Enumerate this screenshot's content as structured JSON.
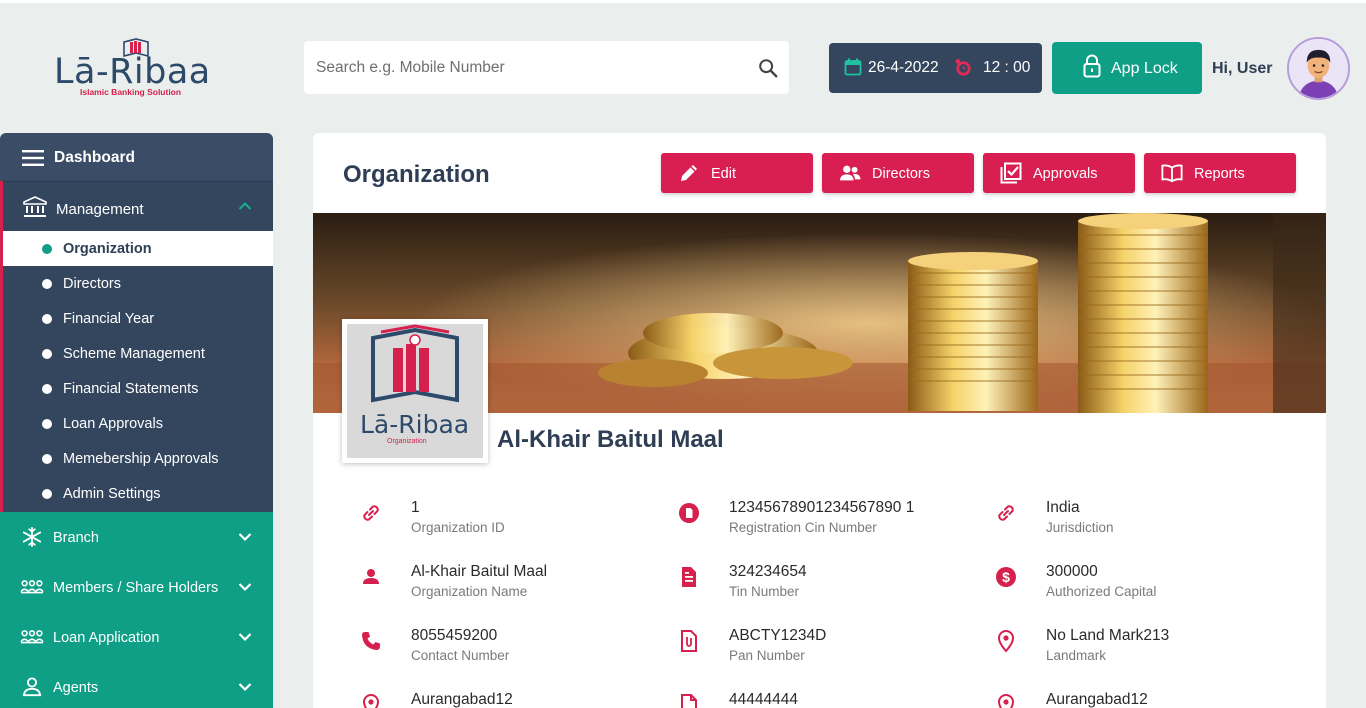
{
  "brand": {
    "name": "Lā-Ribaa",
    "tagline": "Islamic Banking Solution",
    "accent": "#d6204e",
    "navy": "#33465e",
    "teal": "#0f9e86"
  },
  "search": {
    "placeholder": "Search e.g. Mobile Number",
    "value": "",
    "icon": "search-icon"
  },
  "header": {
    "date": "26-4-2022",
    "time": "12 : 00",
    "app_lock_label": "App Lock",
    "greeting": "Hi, User"
  },
  "sidebar": {
    "dashboard": "Dashboard",
    "management": {
      "label": "Management",
      "items": [
        {
          "label": "Organization",
          "active": true
        },
        {
          "label": "Directors"
        },
        {
          "label": "Financial Year"
        },
        {
          "label": "Scheme Management"
        },
        {
          "label": "Financial Statements"
        },
        {
          "label": "Loan Approvals"
        },
        {
          "label": "Memebership Approvals"
        },
        {
          "label": "Admin Settings"
        }
      ]
    },
    "groups": [
      {
        "label": "Branch",
        "icon": "snowflake-icon"
      },
      {
        "label": "Members / Share Holders",
        "icon": "users-group-icon"
      },
      {
        "label": "Loan Application",
        "icon": "users-group-icon"
      },
      {
        "label": "Agents",
        "icon": "user-icon"
      }
    ]
  },
  "main": {
    "title": "Organization",
    "actions": [
      {
        "label": "Edit",
        "icon": "pencil-icon"
      },
      {
        "label": "Directors",
        "icon": "people-icon"
      },
      {
        "label": "Approvals",
        "icon": "checklist-icon"
      },
      {
        "label": "Reports",
        "icon": "book-icon"
      }
    ],
    "org_logo_text": "Lā-Ribaa",
    "org_logo_sub": "Organization",
    "org_name": "Al-Khair Baitul Maal",
    "fields": [
      {
        "value": "1",
        "label": "Organization ID",
        "icon": "link-icon"
      },
      {
        "value": "12345678901234567890 1",
        "label": "Registration Cin Number",
        "icon": "document-icon"
      },
      {
        "value": "India",
        "label": "Jurisdiction",
        "icon": "link-icon"
      },
      {
        "value": "Al-Khair Baitul Maal",
        "label": "Organization Name",
        "icon": "person-icon"
      },
      {
        "value": "324234654",
        "label": "Tin Number",
        "icon": "file-text-icon"
      },
      {
        "value": "300000",
        "label": "Authorized Capital",
        "icon": "dollar-icon"
      },
      {
        "value": "8055459200",
        "label": "Contact Number",
        "icon": "phone-icon"
      },
      {
        "value": "ABCTY1234D",
        "label": "Pan Number",
        "icon": "file-attach-icon"
      },
      {
        "value": "No Land Mark213",
        "label": "Landmark",
        "icon": "location-icon"
      },
      {
        "value": "Aurangabad12",
        "label": "",
        "icon": "location-icon"
      },
      {
        "value": "44444444",
        "label": "",
        "icon": "file-icon"
      },
      {
        "value": "Aurangabad12",
        "label": "",
        "icon": "location-icon"
      }
    ]
  }
}
